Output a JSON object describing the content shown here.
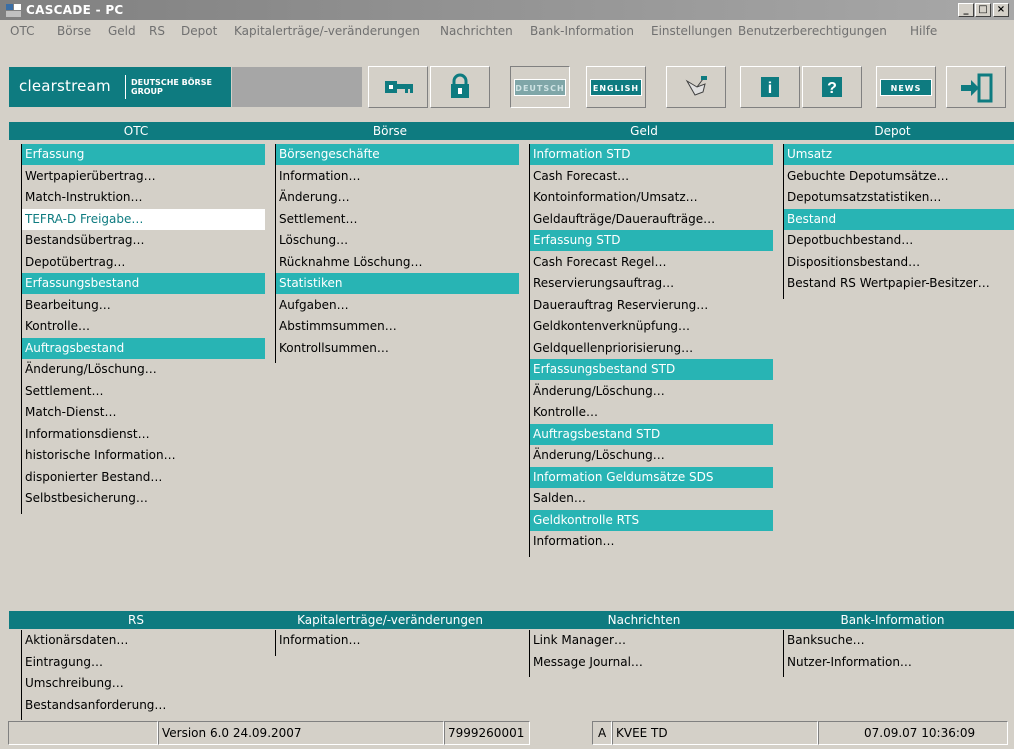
{
  "window": {
    "title": "CASCADE - PC"
  },
  "menu": [
    "OTC",
    "Börse",
    "Geld",
    "RS",
    "Depot",
    "Kapitalerträge/-veränderungen",
    "Nachrichten",
    "Bank-Information",
    "Einstellungen",
    "Benutzerberechtigungen",
    "Hilfe"
  ],
  "toolbar": {
    "logo_text": "clearstream",
    "logo_group_line1": "DEUTSCHE BÖRSE",
    "logo_group_line2": "GROUP",
    "icons": [
      "key-icon",
      "lock-icon",
      "deutsch-language-button",
      "english-language-button",
      "hand-pointer-icon",
      "info-icon",
      "help-icon",
      "news-button",
      "exit-icon"
    ],
    "deutsch_label": "DEUTSCH",
    "english_label": "ENGLISH",
    "news_label": "NEWS",
    "info_label": "i",
    "help_label": "?"
  },
  "panels_top": [
    {
      "title": "OTC",
      "rows": [
        {
          "t": "Erfassung",
          "k": "sec"
        },
        {
          "t": "Wertpapierübertrag…"
        },
        {
          "t": "Match-Instruktion…"
        },
        {
          "t": "TEFRA-D Freigabe…",
          "k": "white"
        },
        {
          "t": "Bestandsübertrag…"
        },
        {
          "t": "Depotübertrag…"
        },
        {
          "t": "Erfassungsbestand",
          "k": "sec"
        },
        {
          "t": "Bearbeitung…"
        },
        {
          "t": "Kontrolle…"
        },
        {
          "t": "Auftragsbestand",
          "k": "sec"
        },
        {
          "t": "Änderung/Löschung…"
        },
        {
          "t": "Settlement…"
        },
        {
          "t": "Match-Dienst…"
        },
        {
          "t": "Informationsdienst…"
        },
        {
          "t": "historische Information…"
        },
        {
          "t": "disponierter Bestand…"
        },
        {
          "t": "Selbstbesicherung…"
        }
      ]
    },
    {
      "title": "Börse",
      "rows": [
        {
          "t": "Börsengeschäfte",
          "k": "sec"
        },
        {
          "t": "Information…"
        },
        {
          "t": "Änderung…"
        },
        {
          "t": "Settlement…"
        },
        {
          "t": "Löschung…"
        },
        {
          "t": "Rücknahme Löschung…"
        },
        {
          "t": "Statistiken",
          "k": "sec"
        },
        {
          "t": "Aufgaben…"
        },
        {
          "t": "Abstimmsummen…"
        },
        {
          "t": "Kontrollsummen…"
        }
      ]
    },
    {
      "title": "Geld",
      "rows": [
        {
          "t": "Information STD",
          "k": "sec"
        },
        {
          "t": "Cash Forecast…"
        },
        {
          "t": "Kontoinformation/Umsatz…"
        },
        {
          "t": "Geldaufträge/Daueraufträge…"
        },
        {
          "t": "Erfassung STD",
          "k": "sec"
        },
        {
          "t": "Cash Forecast Regel…"
        },
        {
          "t": "Reservierungsauftrag…"
        },
        {
          "t": "Dauerauftrag Reservierung…"
        },
        {
          "t": "Geldkontenverknüpfung…"
        },
        {
          "t": "Geldquellenpriorisierung…"
        },
        {
          "t": "Erfassungsbestand STD",
          "k": "sec"
        },
        {
          "t": "Änderung/Löschung…"
        },
        {
          "t": "Kontrolle…"
        },
        {
          "t": "Auftragsbestand STD",
          "k": "sec"
        },
        {
          "t": "Änderung/Löschung…"
        },
        {
          "t": "Information Geldumsätze SDS",
          "k": "sec"
        },
        {
          "t": "Salden…"
        },
        {
          "t": "Geldkontrolle RTS",
          "k": "sec"
        },
        {
          "t": "Information…"
        }
      ]
    },
    {
      "title": "Depot",
      "rows": [
        {
          "t": "Umsatz",
          "k": "sec"
        },
        {
          "t": "Gebuchte Depotumsätze…"
        },
        {
          "t": "Depotumsatzstatistiken…"
        },
        {
          "t": "Bestand",
          "k": "sec"
        },
        {
          "t": "Depotbuchbestand…"
        },
        {
          "t": "Dispositionsbestand…"
        },
        {
          "t": "Bestand RS Wertpapier-Besitzer…"
        }
      ]
    }
  ],
  "panels_bottom": [
    {
      "title": "RS",
      "rows": [
        {
          "t": "Aktionärsdaten…"
        },
        {
          "t": "Eintragung…"
        },
        {
          "t": "Umschreibung…"
        },
        {
          "t": "Bestandsanforderung…"
        }
      ]
    },
    {
      "title": "Kapitalerträge/-veränderungen",
      "rows": [
        {
          "t": "Information…"
        }
      ]
    },
    {
      "title": "Nachrichten",
      "rows": [
        {
          "t": "Link Manager…"
        },
        {
          "t": "Message Journal…"
        }
      ]
    },
    {
      "title": "Bank-Information",
      "rows": [
        {
          "t": "Banksuche…"
        },
        {
          "t": "Nutzer-Information…"
        }
      ]
    }
  ],
  "status": {
    "version": "Version 6.0  24.09.2007",
    "account": "7999260001",
    "mode": "A",
    "user": "KVEE TD",
    "datetime": "07.09.07 10:36:09"
  },
  "colors": {
    "accent": "#0e7b80",
    "section": "#28b4b4",
    "background": "#d4d0c8"
  }
}
